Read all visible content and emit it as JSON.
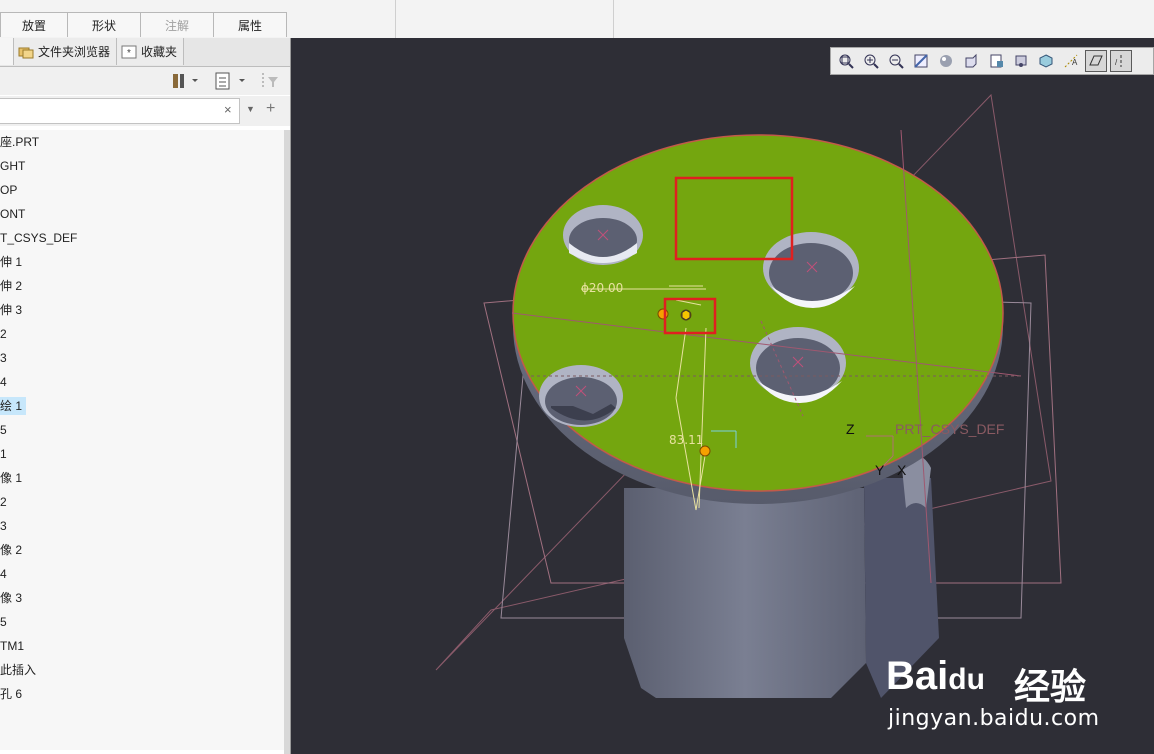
{
  "ribbon": {
    "dashboard_tabs": [
      {
        "label": "放置",
        "disabled": false
      },
      {
        "label": "形状",
        "disabled": false
      },
      {
        "label": "注解",
        "disabled": true
      },
      {
        "label": "属性",
        "disabled": false
      }
    ]
  },
  "panel": {
    "tabs": [
      {
        "label": "文件夹浏览器",
        "icon": "folder-browser-icon"
      },
      {
        "label": "收藏夹",
        "icon": "favorites-icon"
      }
    ],
    "search": {
      "value": "",
      "placeholder": ""
    }
  },
  "tree": {
    "items": [
      {
        "label": "座.PRT"
      },
      {
        "label": "GHT"
      },
      {
        "label": "OP"
      },
      {
        "label": "ONT"
      },
      {
        "label": "T_CSYS_DEF"
      },
      {
        "label": "伸 1"
      },
      {
        "label": "伸 2"
      },
      {
        "label": "伸 3"
      },
      {
        "label": "2"
      },
      {
        "label": "3"
      },
      {
        "label": "4"
      },
      {
        "label": "绘 1",
        "selected": true
      },
      {
        "label": "5"
      },
      {
        "label": "1"
      },
      {
        "label": "像 1"
      },
      {
        "label": "2"
      },
      {
        "label": "3"
      },
      {
        "label": "像 2"
      },
      {
        "label": "4"
      },
      {
        "label": "像 3"
      },
      {
        "label": "5"
      },
      {
        "label": "TM1"
      },
      {
        "label": "此插入"
      },
      {
        "label": "孔 6"
      }
    ]
  },
  "viewport": {
    "dimension_diameter": "ϕ20.00",
    "dimension_offset": "83.11",
    "csys_label": "PRT_CSYS_DEF",
    "axis_z": "Z",
    "axis_y": "Y",
    "axis_x": "X",
    "toolbar_icons": [
      "refit-icon",
      "zoom-in-icon",
      "zoom-out-icon",
      "repaint-icon",
      "display-style-icon",
      "saved-views-icon",
      "view-manager-icon",
      "perspective-icon",
      "spin-center-icon",
      "annotation-display-icon",
      "plane-display-icon",
      "axis-display-icon"
    ],
    "colors": {
      "face": "#74a60f",
      "body": "#6f7487",
      "background": "#2e2e36",
      "highlight_box": "#e02020"
    }
  },
  "watermark": {
    "brand": "Bai",
    "brand2": "du",
    "cn": "经验",
    "url": "jingyan.baidu.com"
  }
}
